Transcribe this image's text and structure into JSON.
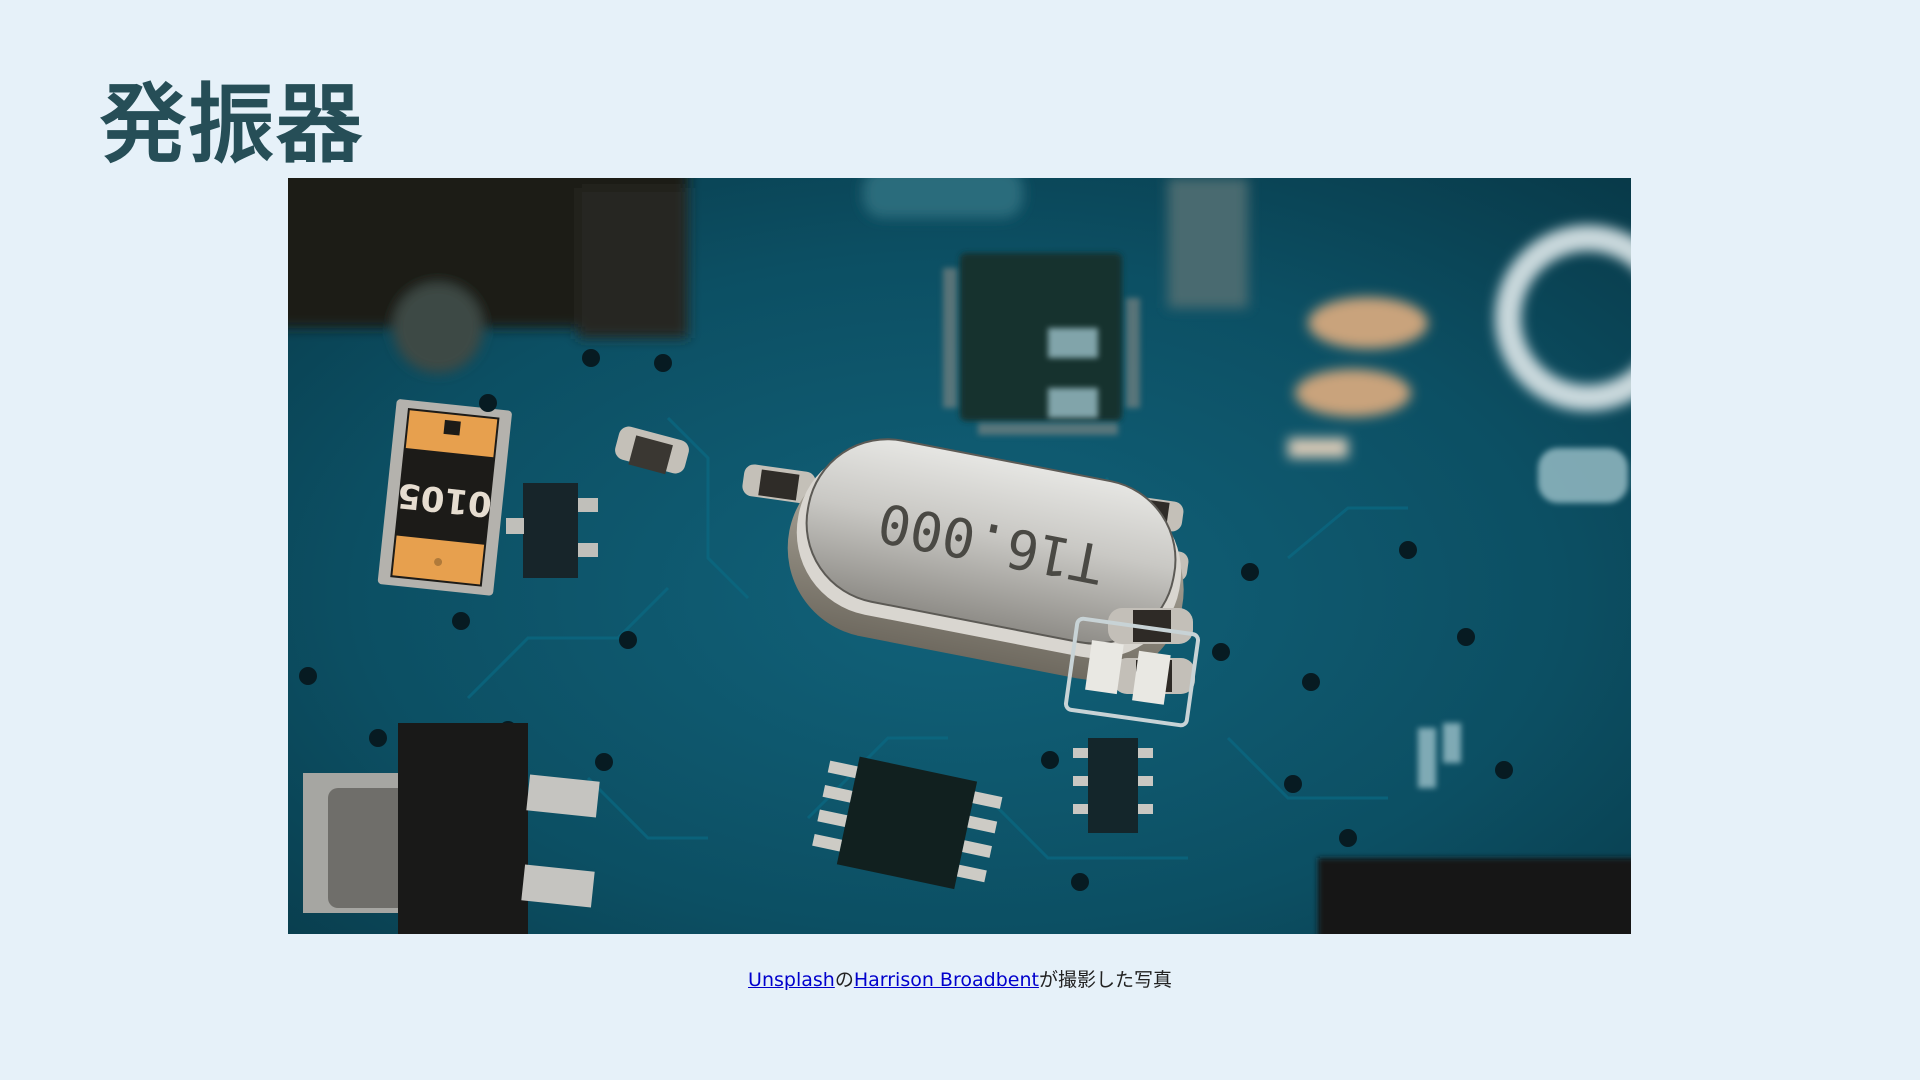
{
  "slide": {
    "title": "発振器"
  },
  "photo": {
    "crystal_marking": "T16.000",
    "chip_marking": "0105"
  },
  "caption": {
    "source_link": "Unsplash",
    "connector": "の",
    "author_link": "Harrison Broadbent",
    "suffix": "が撮影した写真"
  },
  "colors": {
    "background": "#e6f1f9",
    "title": "#264e57",
    "board": "#0d4f61",
    "link": "#0000cc"
  }
}
